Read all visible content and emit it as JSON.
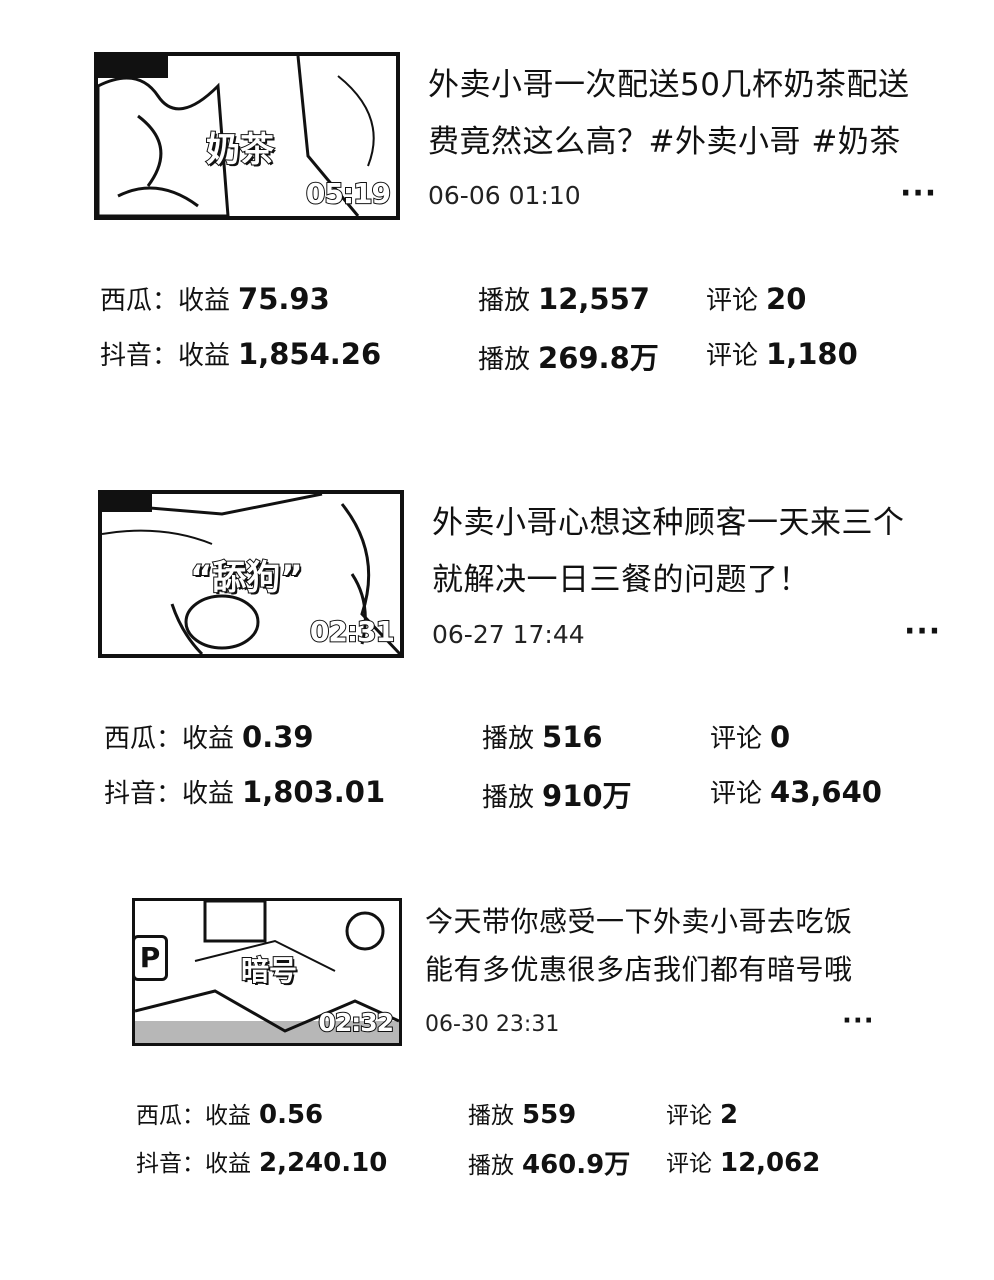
{
  "videos": [
    {
      "thumb_caption": "奶茶",
      "duration": "05:19",
      "title_line1": "外卖小哥一次配送50几杯奶茶配送",
      "title_line2": "费竟然这么高？#外卖小哥 #奶茶",
      "date": "06-06 01:10",
      "more_icon": "more-horizontal-icon",
      "xigua": {
        "platform": "西瓜：",
        "income_label": "收益",
        "income": "75.93",
        "plays_label": "播放",
        "plays": "12,557",
        "comments_label": "评论",
        "comments": "20"
      },
      "douyin": {
        "platform": "抖音：",
        "income_label": "收益",
        "income": "1,854.26",
        "plays_label": "播放",
        "plays": "269.8万",
        "comments_label": "评论",
        "comments": "1,180"
      }
    },
    {
      "thumb_caption": "“舔狗”",
      "duration": "02:31",
      "title_line1": "外卖小哥心想这种顾客一天来三个",
      "title_line2": "就解决一日三餐的问题了！",
      "date": "06-27 17:44",
      "more_icon": "more-horizontal-icon",
      "xigua": {
        "platform": "西瓜：",
        "income_label": "收益",
        "income": "0.39",
        "plays_label": "播放",
        "plays": "516",
        "comments_label": "评论",
        "comments": "0"
      },
      "douyin": {
        "platform": "抖音：",
        "income_label": "收益",
        "income": "1,803.01",
        "plays_label": "播放",
        "plays": "910万",
        "comments_label": "评论",
        "comments": "43,640"
      }
    },
    {
      "thumb_caption": "暗号",
      "duration": "02:32",
      "title_line1": "今天带你感受一下外卖小哥去吃饭",
      "title_line2": "能有多优惠很多店我们都有暗号哦",
      "date": "06-30 23:31",
      "more_icon": "more-horizontal-icon",
      "xigua": {
        "platform": "西瓜：",
        "income_label": "收益",
        "income": "0.56",
        "plays_label": "播放",
        "plays": "559",
        "comments_label": "评论",
        "comments": "2"
      },
      "douyin": {
        "platform": "抖音：",
        "income_label": "收益",
        "income": "2,240.10",
        "plays_label": "播放",
        "plays": "460.9万",
        "comments_label": "评论",
        "comments": "12,062"
      }
    }
  ],
  "overlay_badge": "P",
  "more_glyph": "···"
}
